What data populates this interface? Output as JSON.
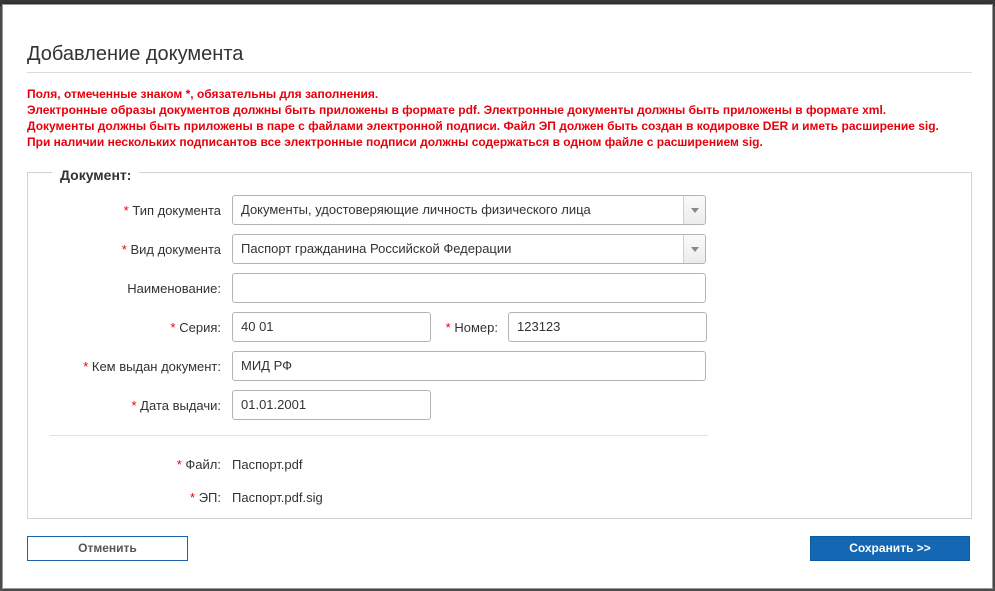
{
  "dialog": {
    "title": "Добавление документа"
  },
  "notes": [
    "Поля, отмеченные знаком *, обязательны для заполнения.",
    "Электронные образы документов должны быть приложены в формате pdf. Электронные документы должны быть приложены в формате xml.",
    "Документы должны быть приложены в паре с файлами электронной подписи. Файл ЭП должен быть создан в кодировке DER и иметь расширение sig.",
    "При наличии нескольких подписантов все электронные подписи должны содержаться в одном файле с расширением sig."
  ],
  "section": {
    "legend": "Документ:"
  },
  "form": {
    "required_mark": "*",
    "doc_type": {
      "label": "Тип документа",
      "value": "Документы, удостоверяющие личность физического лица"
    },
    "doc_kind": {
      "label": "Вид документа",
      "value": "Паспорт гражданина Российской Федерации"
    },
    "name": {
      "label": "Наименование:",
      "value": ""
    },
    "series": {
      "label": "Серия:",
      "value": "40 01"
    },
    "number": {
      "label": "Номер:",
      "value": "123123"
    },
    "issued_by": {
      "label": "Кем выдан документ:",
      "value": "МИД РФ"
    },
    "issue_date": {
      "label": "Дата выдачи:",
      "value": "01.01.2001"
    },
    "file": {
      "label": "Файл:",
      "value": "Паспорт.pdf"
    },
    "signature": {
      "label": "ЭП:",
      "value": "Паспорт.pdf.sig"
    }
  },
  "buttons": {
    "cancel": "Отменить",
    "save": "Сохранить >>"
  },
  "colors": {
    "required": "#e8000b",
    "primary": "#1467b3"
  }
}
